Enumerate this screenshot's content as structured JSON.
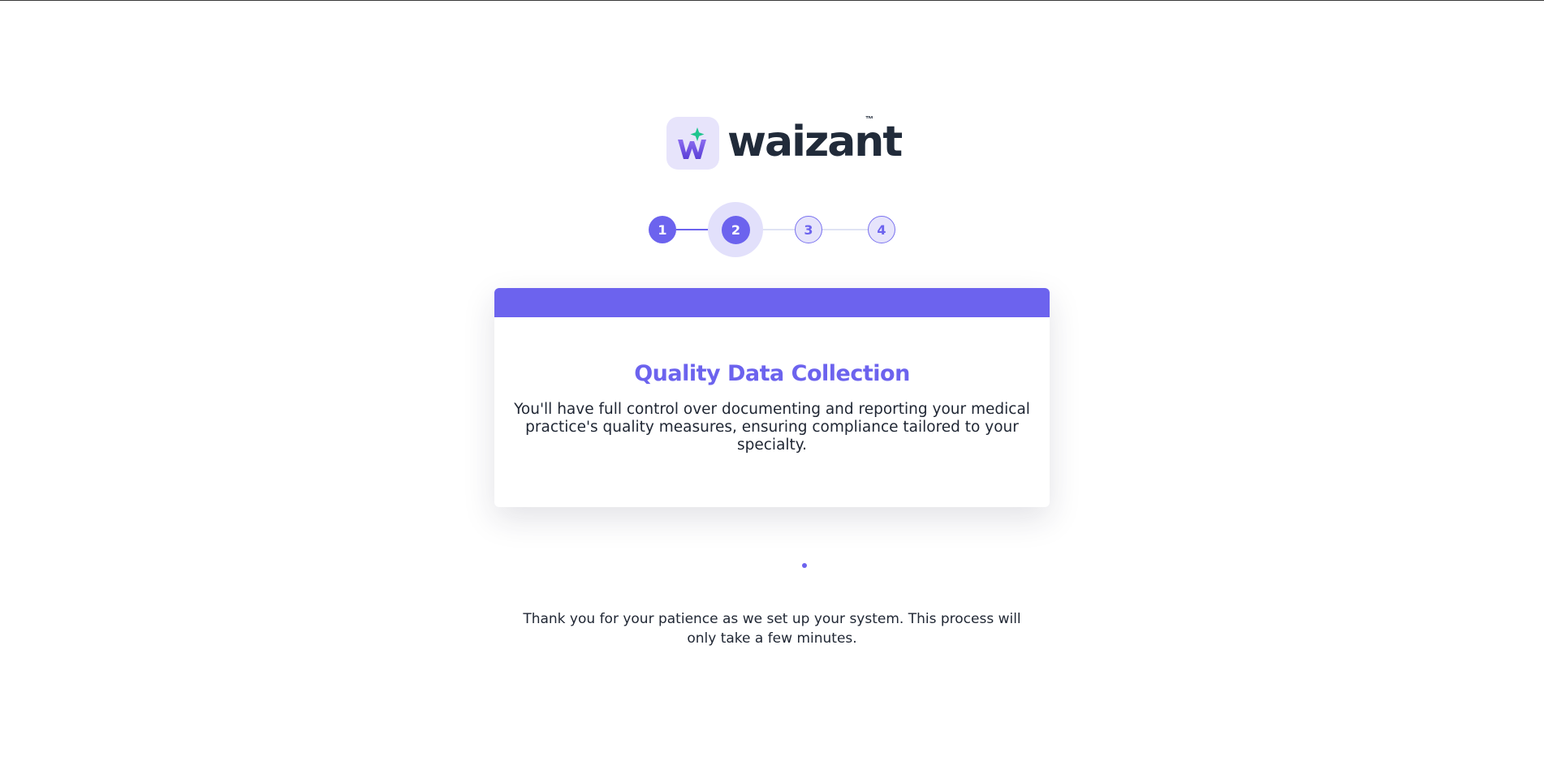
{
  "brand": {
    "name": "waizant",
    "trademark": "™",
    "accent_color": "#6c63ee",
    "sparkle_color": "#1fc58f"
  },
  "stepper": {
    "current_step": 2,
    "steps": [
      {
        "label": "1",
        "status": "complete"
      },
      {
        "label": "2",
        "status": "current"
      },
      {
        "label": "3",
        "status": "pending"
      },
      {
        "label": "4",
        "status": "pending"
      }
    ]
  },
  "card": {
    "title": "Quality Data Collection",
    "body": "You'll have full control over documenting and reporting your medical practice's quality measures, ensuring compliance tailored to your specialty."
  },
  "footer": {
    "message": "Thank you for your patience as we set up your system. This process will only take a few minutes."
  }
}
